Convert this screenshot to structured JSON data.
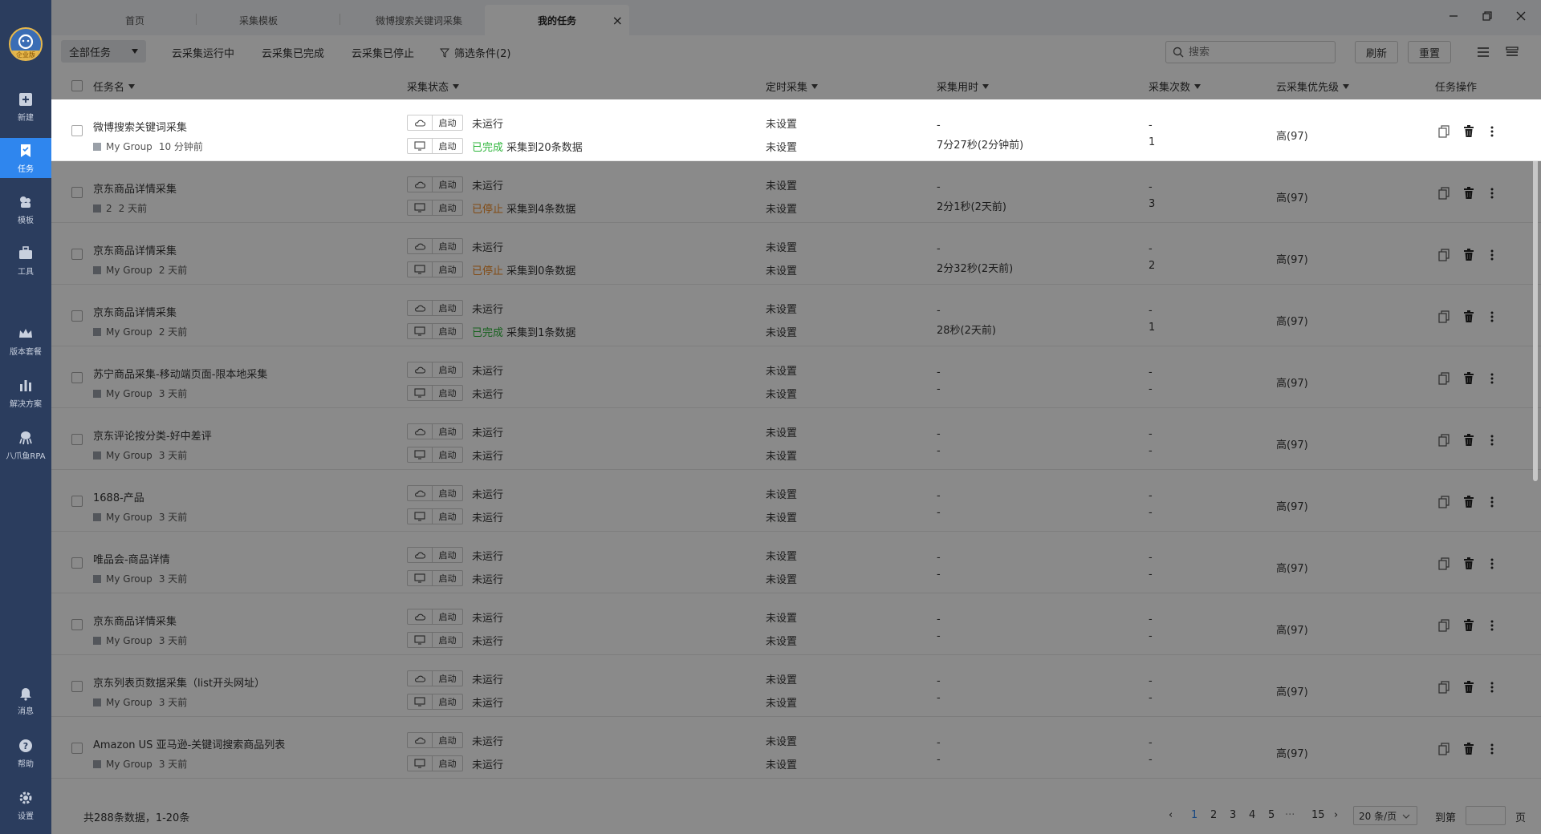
{
  "sidebar": {
    "logo_tag": "企业版",
    "items": [
      {
        "label": "新建",
        "icon": "plus-square-icon"
      },
      {
        "label": "任务",
        "icon": "bookmark-task-icon",
        "active": true
      },
      {
        "label": "模板",
        "icon": "template-icon"
      },
      {
        "label": "工具",
        "icon": "toolbox-icon"
      },
      {
        "label": "版本套餐",
        "icon": "crown-icon"
      },
      {
        "label": "解决方案",
        "icon": "chart-icon"
      },
      {
        "label": "八爪鱼RPA",
        "icon": "octopus-icon"
      },
      {
        "label": "消息",
        "icon": "bell-icon"
      },
      {
        "label": "帮助",
        "icon": "help-icon"
      },
      {
        "label": "设置",
        "icon": "gear-icon"
      }
    ]
  },
  "tabs": [
    "首页",
    "采集模板",
    "微博搜索关键词采集",
    "我的任务"
  ],
  "toolbar": {
    "filter_dropdown": "全部任务",
    "filters": [
      "云采集运行中",
      "云采集已完成",
      "云采集已停止"
    ],
    "filter_conditions": "筛选条件(2)",
    "search_placeholder": "搜索",
    "refresh": "刷新",
    "reset": "重置"
  },
  "columns": [
    "任务名",
    "采集状态",
    "定时采集",
    "采集用时",
    "采集次数",
    "云采集优先级",
    "任务操作"
  ],
  "run_button_label": "启动",
  "tasks": [
    {
      "name": "微博搜索关键词采集",
      "group": "My Group",
      "time": "10 分钟前",
      "cloud_status": "未运行",
      "local_status_tag": "已完成",
      "local_status_tag_color": "green",
      "local_status": "采集到20条数据",
      "cloud_schedule": "未设置",
      "local_schedule": "未设置",
      "cloud_duration": "-",
      "local_duration": "7分27秒(2分钟前)",
      "cloud_count": "-",
      "local_count": "1",
      "priority": "高(97)"
    },
    {
      "name": "京东商品详情采集",
      "group": "2",
      "time": "2 天前",
      "cloud_status": "未运行",
      "local_status_tag": "已停止",
      "local_status_tag_color": "orange",
      "local_status": "采集到4条数据",
      "cloud_schedule": "未设置",
      "local_schedule": "未设置",
      "cloud_duration": "-",
      "local_duration": "2分1秒(2天前)",
      "cloud_count": "-",
      "local_count": "3",
      "priority": "高(97)"
    },
    {
      "name": "京东商品详情采集",
      "group": "My Group",
      "time": "2 天前",
      "cloud_status": "未运行",
      "local_status_tag": "已停止",
      "local_status_tag_color": "orange",
      "local_status": "采集到0条数据",
      "cloud_schedule": "未设置",
      "local_schedule": "未设置",
      "cloud_duration": "-",
      "local_duration": "2分32秒(2天前)",
      "cloud_count": "-",
      "local_count": "2",
      "priority": "高(97)"
    },
    {
      "name": "京东商品详情采集",
      "group": "My Group",
      "time": "2 天前",
      "cloud_status": "未运行",
      "local_status_tag": "已完成",
      "local_status_tag_color": "green",
      "local_status": "采集到1条数据",
      "cloud_schedule": "未设置",
      "local_schedule": "未设置",
      "cloud_duration": "-",
      "local_duration": "28秒(2天前)",
      "cloud_count": "-",
      "local_count": "1",
      "priority": "高(97)"
    },
    {
      "name": "苏宁商品采集-移动端页面-限本地采集",
      "group": "My Group",
      "time": "3 天前",
      "cloud_status": "未运行",
      "local_status_tag": "",
      "local_status_tag_color": "",
      "local_status": "未运行",
      "cloud_schedule": "未设置",
      "local_schedule": "未设置",
      "cloud_duration": "-",
      "local_duration": "-",
      "cloud_count": "-",
      "local_count": "-",
      "priority": "高(97)"
    },
    {
      "name": "京东评论按分类-好中差评",
      "group": "My Group",
      "time": "3 天前",
      "cloud_status": "未运行",
      "local_status_tag": "",
      "local_status_tag_color": "",
      "local_status": "未运行",
      "cloud_schedule": "未设置",
      "local_schedule": "未设置",
      "cloud_duration": "-",
      "local_duration": "-",
      "cloud_count": "-",
      "local_count": "-",
      "priority": "高(97)"
    },
    {
      "name": "1688-产品",
      "group": "My Group",
      "time": "3 天前",
      "cloud_status": "未运行",
      "local_status_tag": "",
      "local_status_tag_color": "",
      "local_status": "未运行",
      "cloud_schedule": "未设置",
      "local_schedule": "未设置",
      "cloud_duration": "-",
      "local_duration": "-",
      "cloud_count": "-",
      "local_count": "-",
      "priority": "高(97)"
    },
    {
      "name": "唯品会-商品详情",
      "group": "My Group",
      "time": "3 天前",
      "cloud_status": "未运行",
      "local_status_tag": "",
      "local_status_tag_color": "",
      "local_status": "未运行",
      "cloud_schedule": "未设置",
      "local_schedule": "未设置",
      "cloud_duration": "-",
      "local_duration": "-",
      "cloud_count": "-",
      "local_count": "-",
      "priority": "高(97)"
    },
    {
      "name": "京东商品详情采集",
      "group": "My Group",
      "time": "3 天前",
      "cloud_status": "未运行",
      "local_status_tag": "",
      "local_status_tag_color": "",
      "local_status": "未运行",
      "cloud_schedule": "未设置",
      "local_schedule": "未设置",
      "cloud_duration": "-",
      "local_duration": "-",
      "cloud_count": "-",
      "local_count": "-",
      "priority": "高(97)"
    },
    {
      "name": "京东列表页数据采集（list开头网址）",
      "group": "My Group",
      "time": "3 天前",
      "cloud_status": "未运行",
      "local_status_tag": "",
      "local_status_tag_color": "",
      "local_status": "未运行",
      "cloud_schedule": "未设置",
      "local_schedule": "未设置",
      "cloud_duration": "-",
      "local_duration": "-",
      "cloud_count": "-",
      "local_count": "-",
      "priority": "高(97)"
    },
    {
      "name": "Amazon US 亚马逊-关键词搜索商品列表",
      "group": "My Group",
      "time": "3 天前",
      "cloud_status": "未运行",
      "local_status_tag": "",
      "local_status_tag_color": "",
      "local_status": "未运行",
      "cloud_schedule": "未设置",
      "local_schedule": "未设置",
      "cloud_duration": "-",
      "local_duration": "-",
      "cloud_count": "-",
      "local_count": "-",
      "priority": "高(97)"
    }
  ],
  "footer": {
    "summary": "共288条数据，1-20条",
    "pages": [
      "1",
      "2",
      "3",
      "4",
      "5"
    ],
    "ellipsis": "···",
    "last_page": "15",
    "current_page": "1",
    "per_page": "20 条/页",
    "goto_label": "到第",
    "goto_suffix": "页"
  },
  "colors": {
    "sidebar_bg": "#2b3d5e",
    "accent": "#2f86ee",
    "completed": "#2db53a",
    "stopped": "#f08a24"
  }
}
